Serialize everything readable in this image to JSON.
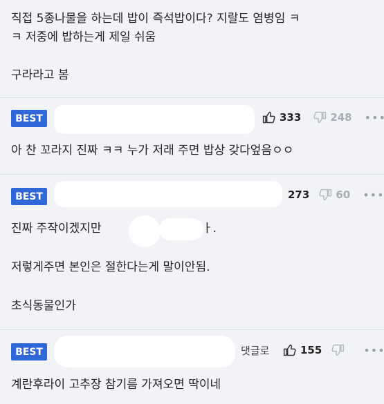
{
  "post": {
    "lines": [
      "직접 5종나물을 하는데 밥이 즉석밥이다? 지랄도 염병임 ㅋ",
      "ㅋ 저중에 밥하는게 제일 쉬움",
      "구라라고 봄"
    ]
  },
  "comments": [
    {
      "badge": "BEST",
      "likes": "333",
      "dislikes": "248",
      "more": "•••",
      "lines": [
        "아 찬 꼬라지 진짜 ㅋㅋ 누가 저래 주면 밥상 갖다엎음ㅇㅇ"
      ]
    },
    {
      "badge": "BEST",
      "likes": "273",
      "dislikes": "60",
      "more": "•••",
      "lines": [
        "진짜 주작이겠지만",
        "ㅏ.",
        "저렇게주면 본인은 절한다는게 말이안됨.",
        "초식동물인가"
      ]
    },
    {
      "badge": "BEST",
      "reply": "댓글로",
      "likes": "155",
      "dislikes": "",
      "more": "•••",
      "lines": [
        "계란후라이 고추장 참기름 가져오면 딱이네"
      ]
    }
  ],
  "icons": {
    "like": "thumbs-up-icon",
    "dislike": "thumbs-down-icon",
    "more": "more-dots-icon"
  },
  "colors": {
    "badge": "#2f66d8",
    "background": "#f1f3f6",
    "separator": "#dcdfe4"
  }
}
